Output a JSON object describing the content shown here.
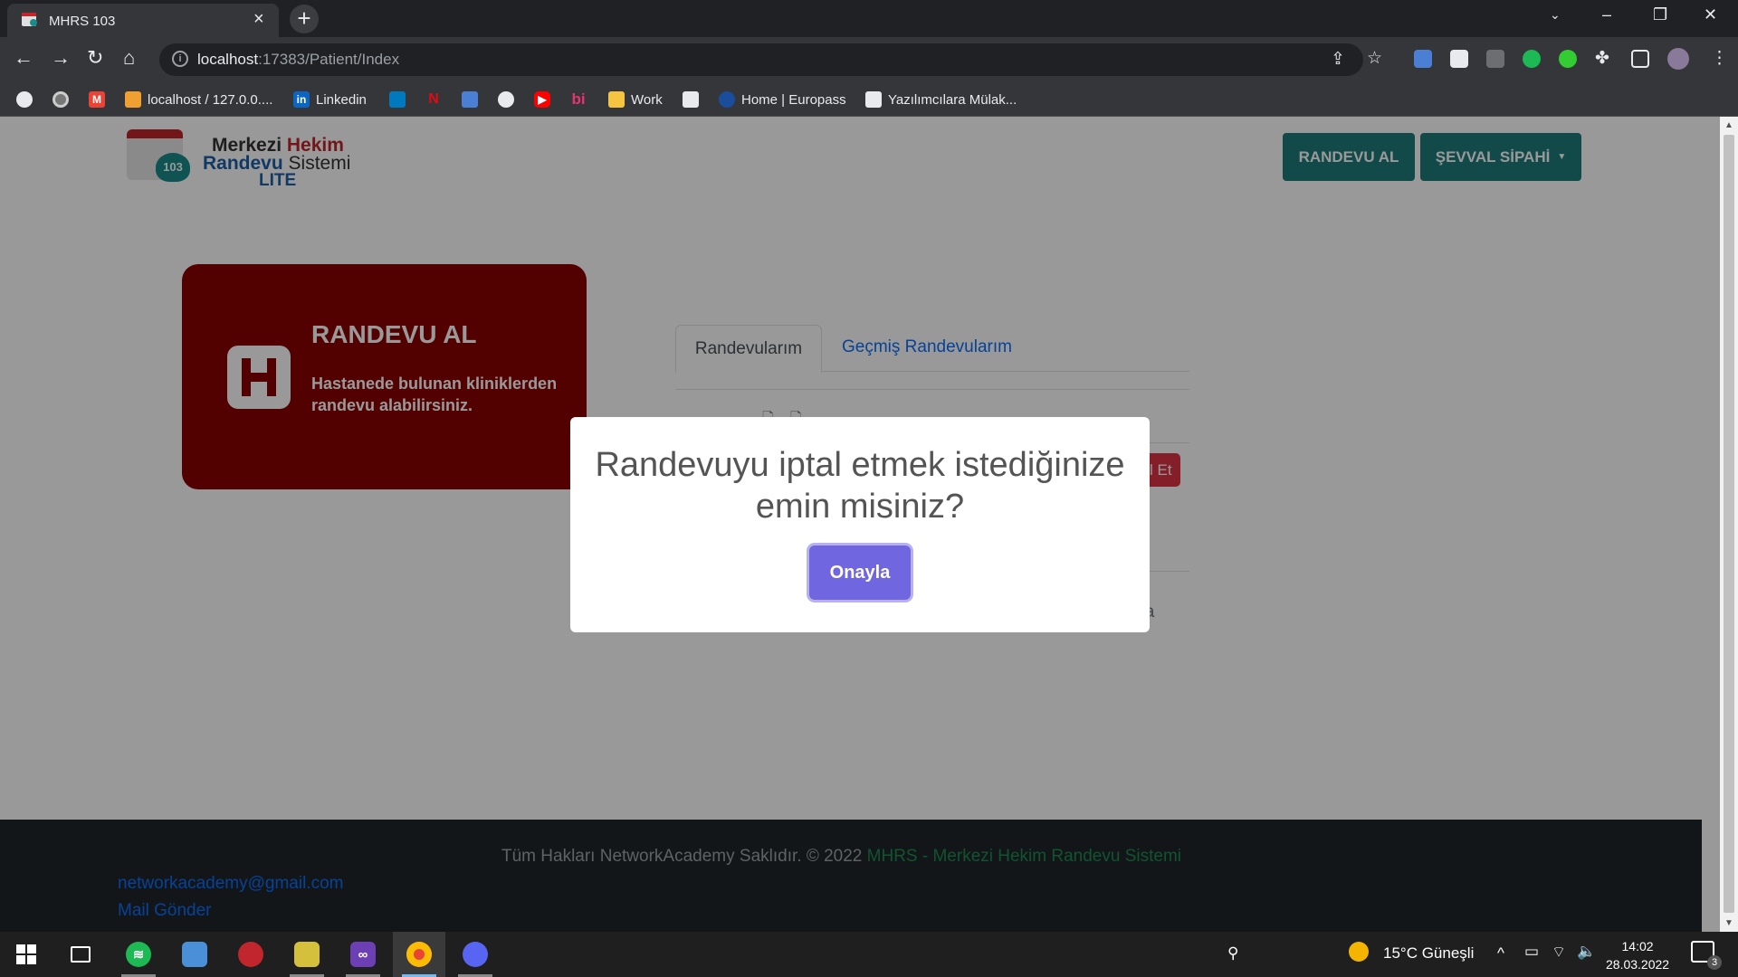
{
  "browser": {
    "tab_title": "MHRS 103",
    "url_host": "localhost",
    "url_rest": ":17383/Patient/Index",
    "bookmarks": [
      {
        "label": ""
      },
      {
        "label": ""
      },
      {
        "label": ""
      },
      {
        "label": "localhost / 127.0.0...."
      },
      {
        "label": "Linkedin"
      },
      {
        "label": ""
      },
      {
        "label": ""
      },
      {
        "label": ""
      },
      {
        "label": ""
      },
      {
        "label": ""
      },
      {
        "label": ""
      },
      {
        "label": "Work"
      },
      {
        "label": ""
      },
      {
        "label": "Home | Europass"
      },
      {
        "label": "Yazılımcılara Mülak..."
      }
    ]
  },
  "header": {
    "logo": {
      "line1_a": "Merkezi ",
      "line1_b": "Hekim",
      "line2_a": "Randevu",
      "line2_b": " Sistemi",
      "line3": "LITE",
      "badge": "103"
    },
    "randevu_button": "RANDEVU AL",
    "user_button": "ŞEVVAL SİPAHİ"
  },
  "card": {
    "title": "RANDEVU AL",
    "description": "Hastanede bulunan kliniklerden randevu alabilirsiniz."
  },
  "tabs": {
    "active": "Randevularım",
    "other": "Geçmiş Randevularım"
  },
  "behind": {
    "cancel_partial": "l Et",
    "page_partial": "yfa"
  },
  "modal": {
    "title": "Randevuyu iptal etmek istediğinize emin misiniz?",
    "confirm": "Onayla"
  },
  "footer": {
    "copyright": "Tüm Hakları NetworkAcademy Saklıdır. © 2022 ",
    "site": "MHRS - Merkezi Hekim Randevu Sistemi",
    "email": "networkacademy@gmail.com",
    "send": "Mail Gönder"
  },
  "taskbar": {
    "weather": "15°C  Güneşli",
    "time": "14:02",
    "date": "28.03.2022",
    "notifications": "3"
  }
}
